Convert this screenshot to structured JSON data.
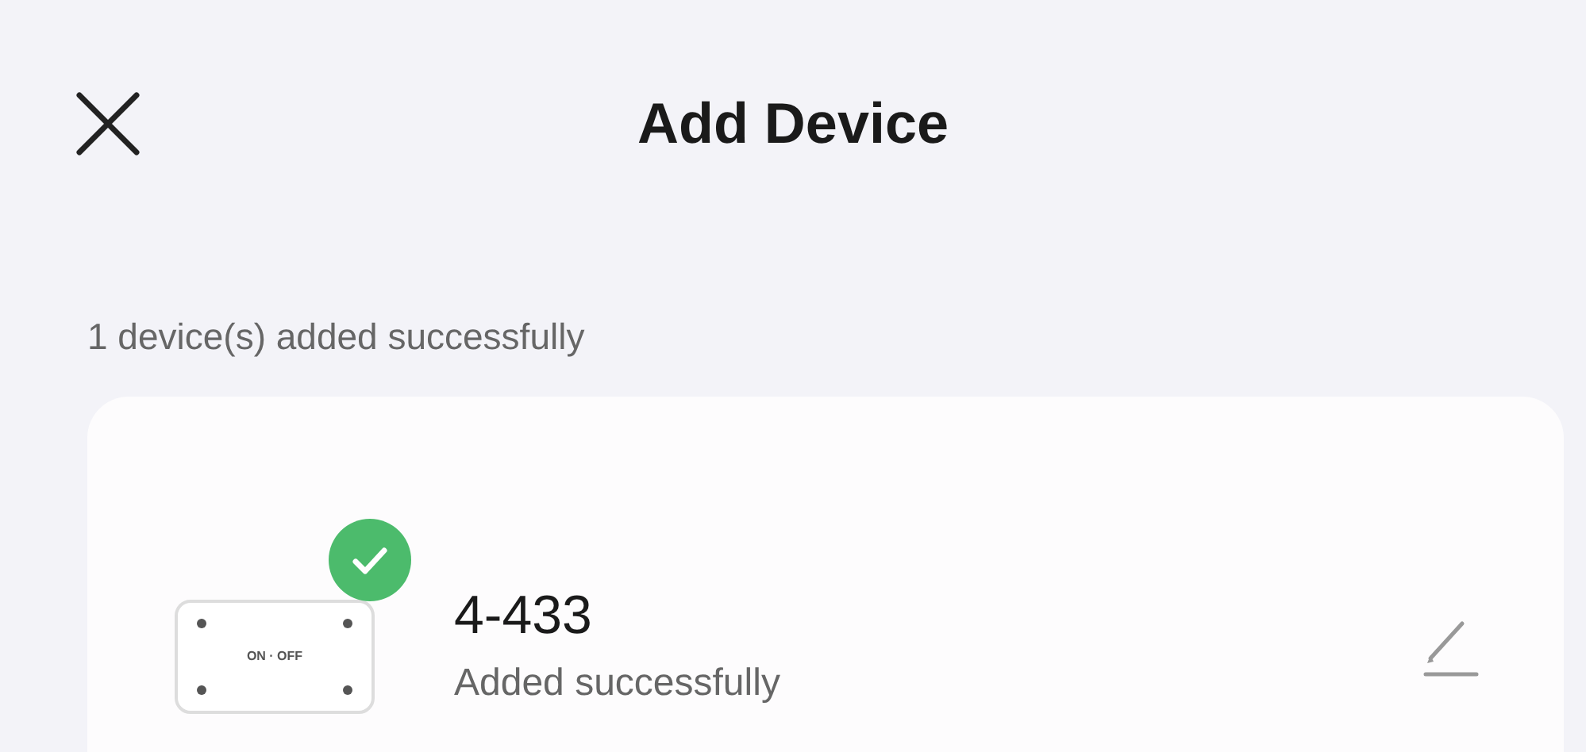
{
  "header": {
    "title": "Add Device"
  },
  "summary": "1 device(s) added successfully",
  "devices": [
    {
      "name": "4-433",
      "status": "Added successfully",
      "added": true,
      "icon_label": "ON · OFF"
    }
  ]
}
